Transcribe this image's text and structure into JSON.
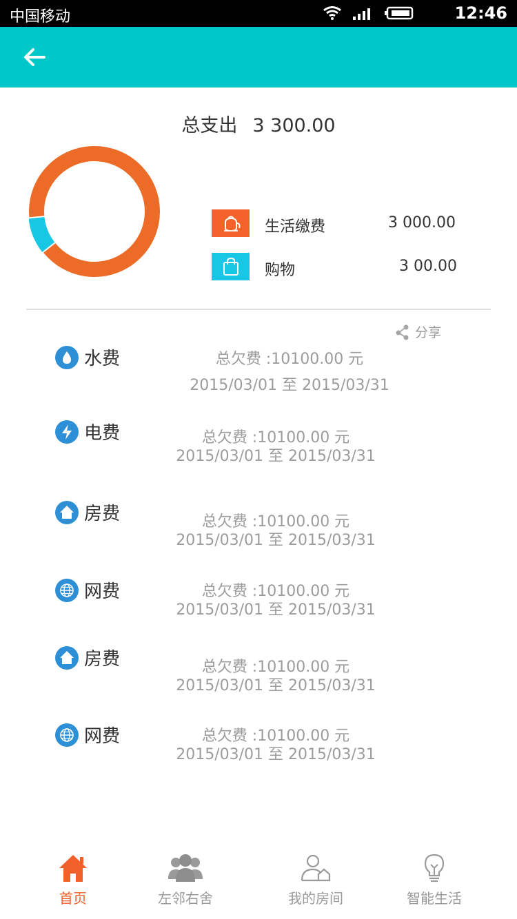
{
  "status_bar": {
    "carrier": "中国移动",
    "time": "12:46"
  },
  "summary": {
    "total_label": "总支出",
    "total_value": "3 300.00",
    "colors": {
      "living": "#ec6b26",
      "shopping": "#17c7e4"
    },
    "share_of_total": {
      "living": 0.909,
      "shopping": 0.091
    }
  },
  "legend": [
    {
      "label": "生活缴费",
      "amount": "3 000.00",
      "color": "#f4622a",
      "icon": "teapot-icon"
    },
    {
      "label": "购物",
      "amount": "3 00.00",
      "color": "#17c7e4",
      "icon": "shopping-bag-icon"
    }
  ],
  "share_label": "分享",
  "bills": [
    {
      "name": "水费",
      "icon": "water-drop-icon",
      "owed": "总欠费 :10100.00 元",
      "period": "2015/03/01 至 2015/03/31"
    },
    {
      "name": "电费",
      "icon": "lightning-icon",
      "owed": "总欠费 :10100.00 元",
      "period": "2015/03/01 至 2015/03/31"
    },
    {
      "name": "房费",
      "icon": "house-icon",
      "owed": "总欠费 :10100.00 元",
      "period": "2015/03/01 至 2015/03/31"
    },
    {
      "name": "网费",
      "icon": "globe-icon",
      "owed": "总欠费 :10100.00 元",
      "period": "2015/03/01 至 2015/03/31"
    },
    {
      "name": "房费",
      "icon": "house-icon",
      "owed": "总欠费 :10100.00 元",
      "period": "2015/03/01 至 2015/03/31"
    },
    {
      "name": "网费",
      "icon": "globe-icon",
      "owed": "总欠费 :10100.00 元",
      "period": "2015/03/01 至 2015/03/31"
    }
  ],
  "tabs": [
    {
      "label": "首页",
      "icon": "home-icon",
      "active": true
    },
    {
      "label": "左邻右舍",
      "icon": "people-icon",
      "active": false
    },
    {
      "label": "我的房间",
      "icon": "person-house-icon",
      "active": false
    },
    {
      "label": "智能生活",
      "icon": "lightbulb-icon",
      "active": false
    }
  ],
  "theme": {
    "header": "#00c8c9",
    "icon_blue": "#2d8fd6",
    "accent": "#f2612c"
  }
}
